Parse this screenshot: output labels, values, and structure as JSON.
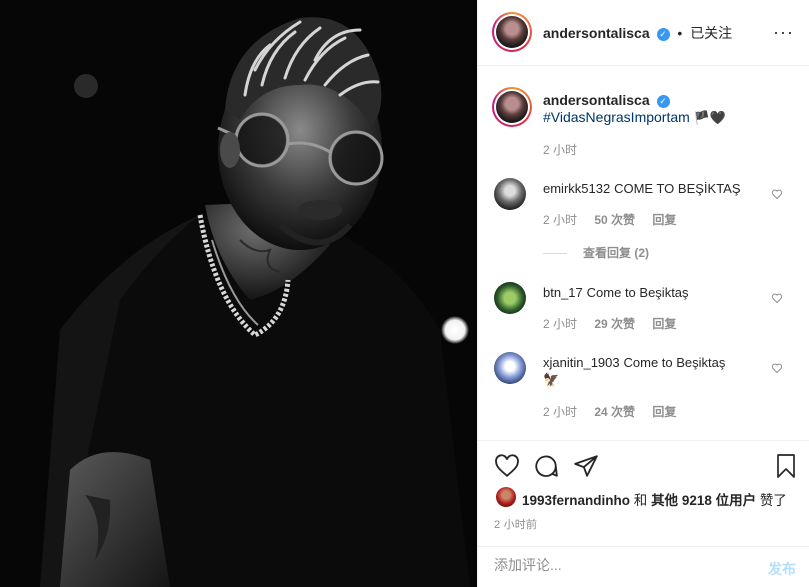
{
  "header": {
    "username": "andersontalisca",
    "verified_icon": "verified-badge-icon",
    "separator": "•",
    "follow_status": "已关注",
    "more_icon": "more-options-icon"
  },
  "caption": {
    "username": "andersontalisca",
    "hashtag": "#VidasNegrasImportam",
    "emoji": "🏴🖤",
    "time": "2 小时"
  },
  "comments": [
    {
      "username": "emirkk5132",
      "text": "COME TO BEŞİKTAŞ",
      "time": "2 小时",
      "likes": "50 次赞",
      "reply": "回复",
      "view_replies": "查看回复 (2)"
    },
    {
      "username": "btn_17",
      "text": "Come to Beşiktaş",
      "time": "2 小时",
      "likes": "29 次赞",
      "reply": "回复"
    },
    {
      "username": "xjanitin_1903",
      "text": "Come to Beşiktaş",
      "emoji": "🦅",
      "time": "2 小时",
      "likes": "24 次赞",
      "reply": "回复"
    }
  ],
  "likes": {
    "liker": "1993fernandinho",
    "conj": "和",
    "others": "其他 9218 位用户",
    "suffix": "赞了"
  },
  "timestamp": "2 小时前",
  "add_comment": {
    "placeholder": "添加评论...",
    "post_label": "发布"
  },
  "colors": {
    "link": "#003569",
    "verified": "#3897f0",
    "muted": "#8e8e8e",
    "post_disabled": "#b2dffc"
  }
}
